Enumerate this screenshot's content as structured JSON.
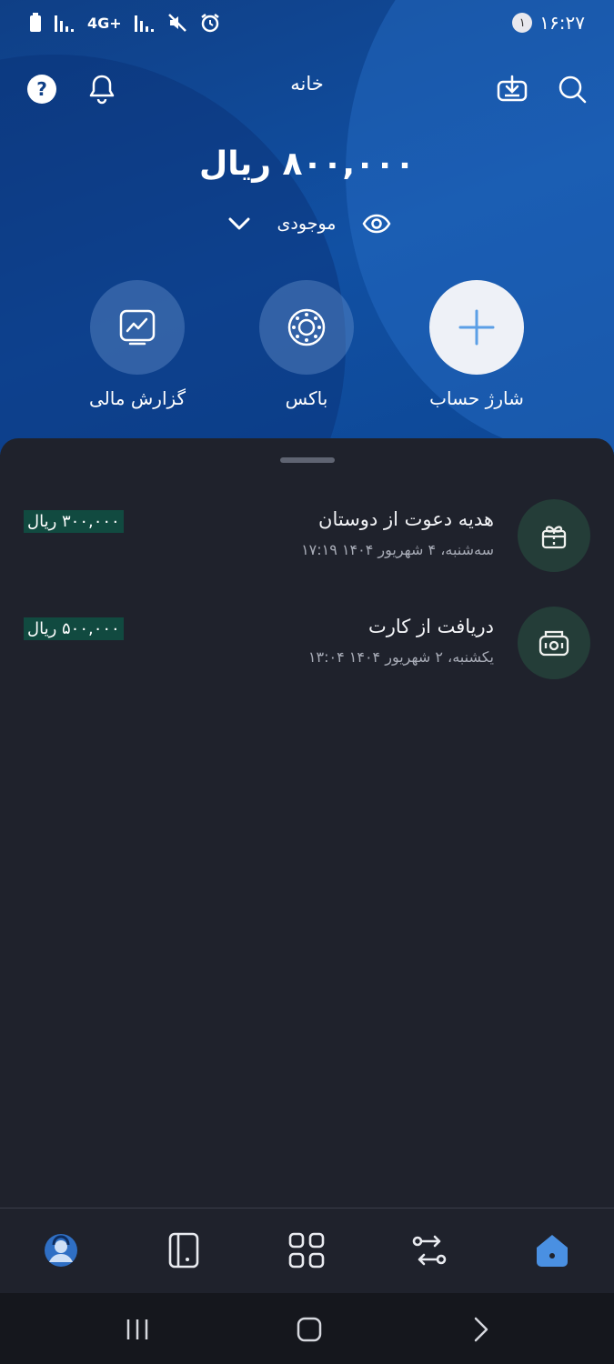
{
  "status_bar": {
    "time": "۱۶:۲۷",
    "notification_count": "۱",
    "network": "4G+"
  },
  "header": {
    "title": "خانه"
  },
  "balance": {
    "amount": "۸۰۰,۰۰۰ ریال",
    "label": "موجودی"
  },
  "actions": [
    {
      "label": "شارژ حساب",
      "icon": "plus-icon"
    },
    {
      "label": "باکس",
      "icon": "box-icon"
    },
    {
      "label": "گزارش مالی",
      "icon": "chart-icon"
    }
  ],
  "transactions": [
    {
      "title": "هدیه دعوت از دوستان",
      "date": "سه‌شنبه، ۴ شهریور ۱۴۰۴ ۱۷:۱۹",
      "amount": "۳۰۰,۰۰۰ ریال",
      "icon": "gift-icon"
    },
    {
      "title": "دریافت از کارت",
      "date": "یکشنبه، ۲ شهریور ۱۴۰۴ ۱۳:۰۴",
      "amount": "۵۰۰,۰۰۰ ریال",
      "icon": "cash-icon"
    }
  ],
  "colors": {
    "primary": "#0f3f86",
    "accent": "#4a90e2",
    "sheet_bg": "#1f222c",
    "amount_bg": "#114a40",
    "icon_bg": "#243d38"
  }
}
